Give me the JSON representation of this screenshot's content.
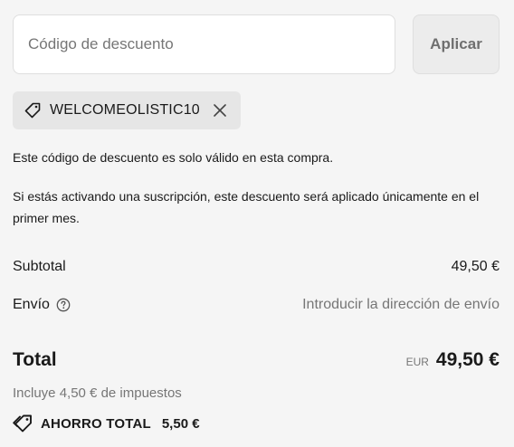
{
  "discount": {
    "placeholder": "Código de descuento",
    "value": "",
    "apply_label": "Aplicar"
  },
  "applied_code": {
    "code": "WELCOMEOLISTIC10",
    "tag_icon": "tag-icon",
    "remove_icon": "close-icon"
  },
  "notes": {
    "single_use": "Este código de descuento es solo válido en esta compra.",
    "subscription": "Si estás activando una suscripción, este descuento será aplicado únicamente en el primer mes."
  },
  "summary": {
    "subtotal_label": "Subtotal",
    "subtotal_value": "49,50 €",
    "shipping_label": "Envío",
    "shipping_help_icon": "question-circle-icon",
    "shipping_value": "Introducir la dirección de envío",
    "total_label": "Total",
    "currency_code": "EUR",
    "total_value": "49,50 €",
    "taxes_note": "Incluye 4,50 € de impuestos",
    "savings_icon": "tag-icon",
    "savings_label": "AHORRO TOTAL",
    "savings_value": "5,50 €"
  },
  "colors": {
    "background": "#f5f5f5",
    "muted_text": "#767676",
    "chip_background": "#e6e6e6"
  }
}
